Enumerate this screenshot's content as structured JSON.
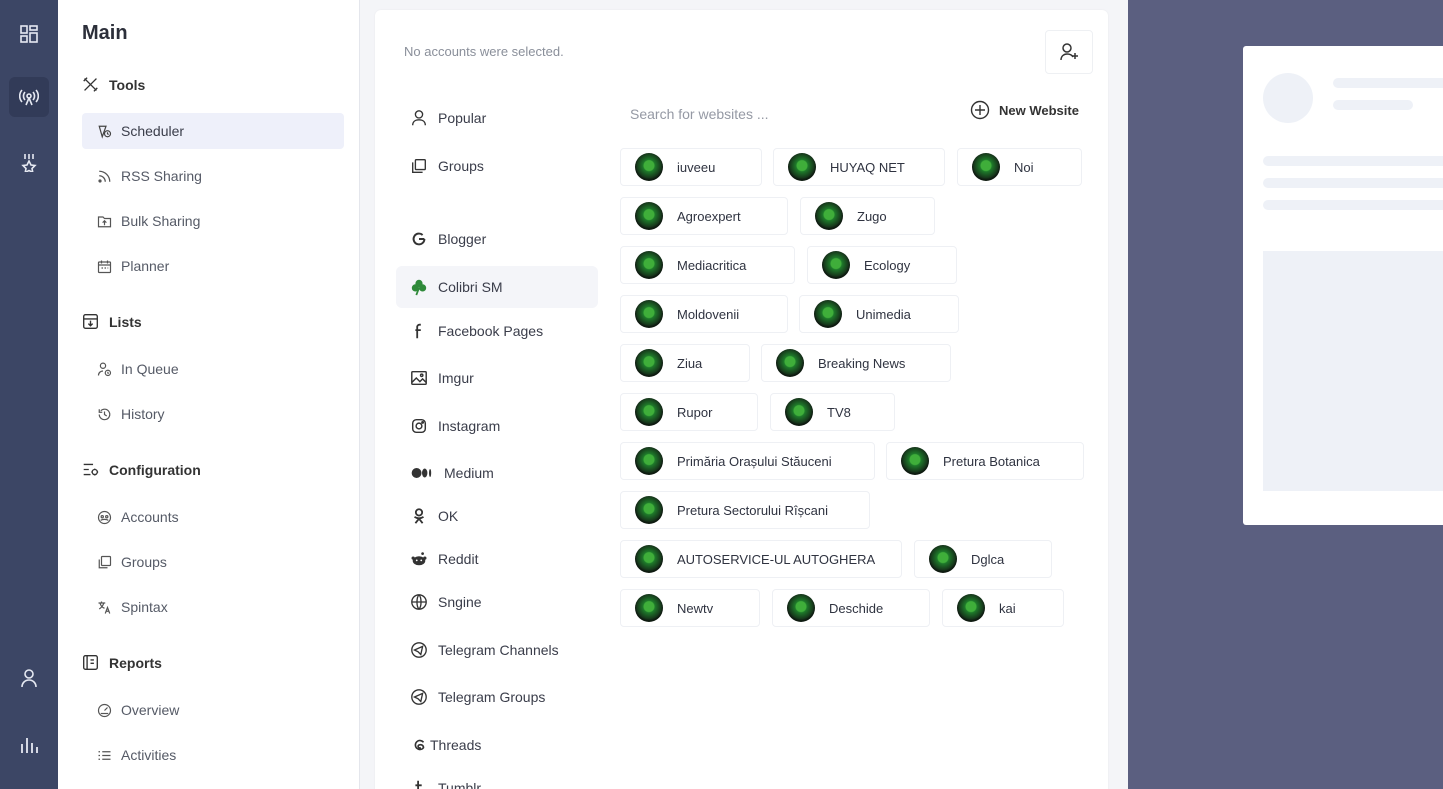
{
  "rail": {
    "icons": [
      "dashboard-icon",
      "broadcast-icon",
      "award-icon",
      "user-icon",
      "chart-icon"
    ]
  },
  "nav": {
    "title": "Main",
    "sections": {
      "tools": {
        "label": "Tools",
        "items": [
          "Scheduler",
          "RSS Sharing",
          "Bulk Sharing",
          "Planner"
        ]
      },
      "lists": {
        "label": "Lists",
        "items": [
          "In Queue",
          "History"
        ]
      },
      "configuration": {
        "label": "Configuration",
        "items": [
          "Accounts",
          "Groups",
          "Spintax"
        ]
      },
      "reports": {
        "label": "Reports",
        "items": [
          "Overview",
          "Activities"
        ]
      }
    },
    "active_item": "Scheduler"
  },
  "composer": {
    "no_accounts_text": "No accounts were selected.",
    "categories": [
      "Popular",
      "Groups",
      "Blogger",
      "Colibri SM",
      "Facebook Pages",
      "Imgur",
      "Instagram",
      "Medium",
      "OK",
      "Reddit",
      "Sngine",
      "Telegram Channels",
      "Telegram Groups",
      "Threads",
      "Tumblr"
    ],
    "active_category": "Colibri SM",
    "search_placeholder": "Search for websites ...",
    "new_website_label": "New Website",
    "websites": [
      "iuveeu",
      "HUYAQ NET",
      "Noi",
      "Agroexpert",
      "Zugo",
      "Mediacritica",
      "Ecology",
      "Moldovenii",
      "Unimedia",
      "Ziua",
      "Breaking News",
      "Rupor",
      "TV8",
      "Primăria Orașului Stăuceni",
      "Pretura Botanica",
      "Pretura Sectorului Rîșcani",
      "AUTOSERVICE-UL AUTOGHERA",
      "Dglca",
      "Newtv",
      "Deschide",
      "kai"
    ]
  },
  "colors": {
    "rail": "#3c4665",
    "overlay": "#5b5f80",
    "active_nav": "#eef0fa"
  }
}
